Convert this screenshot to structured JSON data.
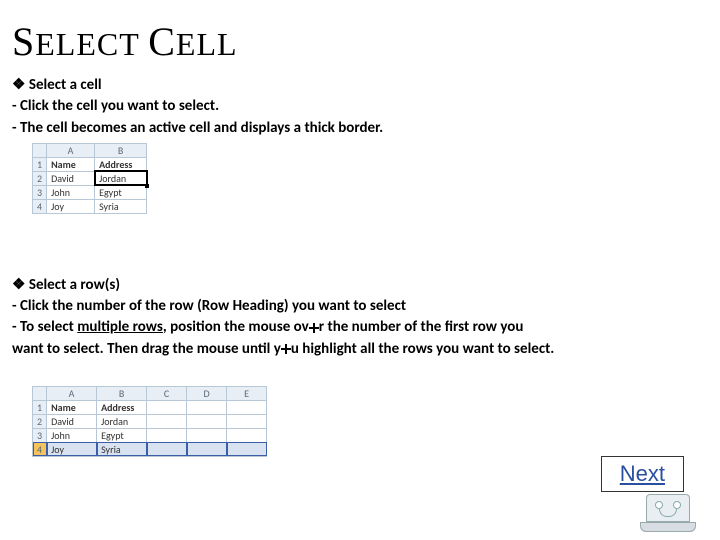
{
  "title": {
    "w1a": "S",
    "w1b": "ELECT",
    "w2a": "C",
    "w2b": "ELL"
  },
  "bullet": "❖",
  "sec1": {
    "head": "Select a cell",
    "l1": "- Click the cell you want to select.",
    "l2": "- The cell becomes an active cell and displays a thick border."
  },
  "table1": {
    "cols": [
      "",
      "A",
      "B"
    ],
    "rows": [
      {
        "n": "1",
        "a": "Name",
        "b": "Address"
      },
      {
        "n": "2",
        "a": "David",
        "b": "Jordan",
        "selected": true
      },
      {
        "n": "3",
        "a": "John",
        "b": "Egypt"
      },
      {
        "n": "4",
        "a": "Joy",
        "b": "Syria"
      }
    ]
  },
  "sec2": {
    "head": "Select a row(s)",
    "l1": "- Click the number of the row (Row Heading) you want to select",
    "l2a": "- To select ",
    "l2u": "multiple rows",
    "l2b": ", position the mouse    ov",
    "l2c": "r the number of the first row you",
    "l3a": "want",
    "l3b": " to select. Then drag the mouse    until y",
    "l3c": "u highlight all the rows you want to select."
  },
  "table2": {
    "cols": [
      "",
      "A",
      "B",
      "C",
      "D",
      "E"
    ],
    "rows": [
      {
        "n": "1",
        "a": "Name",
        "b": "Address"
      },
      {
        "n": "2",
        "a": "David",
        "b": "Jordan"
      },
      {
        "n": "3",
        "a": "John",
        "b": "Egypt"
      },
      {
        "n": "4",
        "a": "Joy",
        "b": "Syria",
        "selected": true
      }
    ]
  },
  "next": "Next"
}
